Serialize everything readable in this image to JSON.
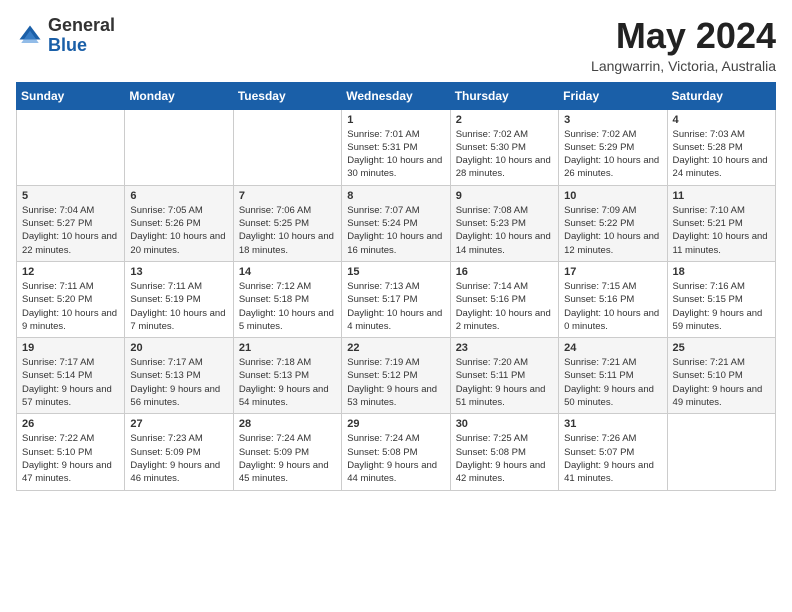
{
  "header": {
    "logo_general": "General",
    "logo_blue": "Blue",
    "month_title": "May 2024",
    "location": "Langwarrin, Victoria, Australia"
  },
  "weekdays": [
    "Sunday",
    "Monday",
    "Tuesday",
    "Wednesday",
    "Thursday",
    "Friday",
    "Saturday"
  ],
  "weeks": [
    [
      {
        "day": "",
        "sunrise": "",
        "sunset": "",
        "daylight": ""
      },
      {
        "day": "",
        "sunrise": "",
        "sunset": "",
        "daylight": ""
      },
      {
        "day": "",
        "sunrise": "",
        "sunset": "",
        "daylight": ""
      },
      {
        "day": "1",
        "sunrise": "Sunrise: 7:01 AM",
        "sunset": "Sunset: 5:31 PM",
        "daylight": "Daylight: 10 hours and 30 minutes."
      },
      {
        "day": "2",
        "sunrise": "Sunrise: 7:02 AM",
        "sunset": "Sunset: 5:30 PM",
        "daylight": "Daylight: 10 hours and 28 minutes."
      },
      {
        "day": "3",
        "sunrise": "Sunrise: 7:02 AM",
        "sunset": "Sunset: 5:29 PM",
        "daylight": "Daylight: 10 hours and 26 minutes."
      },
      {
        "day": "4",
        "sunrise": "Sunrise: 7:03 AM",
        "sunset": "Sunset: 5:28 PM",
        "daylight": "Daylight: 10 hours and 24 minutes."
      }
    ],
    [
      {
        "day": "5",
        "sunrise": "Sunrise: 7:04 AM",
        "sunset": "Sunset: 5:27 PM",
        "daylight": "Daylight: 10 hours and 22 minutes."
      },
      {
        "day": "6",
        "sunrise": "Sunrise: 7:05 AM",
        "sunset": "Sunset: 5:26 PM",
        "daylight": "Daylight: 10 hours and 20 minutes."
      },
      {
        "day": "7",
        "sunrise": "Sunrise: 7:06 AM",
        "sunset": "Sunset: 5:25 PM",
        "daylight": "Daylight: 10 hours and 18 minutes."
      },
      {
        "day": "8",
        "sunrise": "Sunrise: 7:07 AM",
        "sunset": "Sunset: 5:24 PM",
        "daylight": "Daylight: 10 hours and 16 minutes."
      },
      {
        "day": "9",
        "sunrise": "Sunrise: 7:08 AM",
        "sunset": "Sunset: 5:23 PM",
        "daylight": "Daylight: 10 hours and 14 minutes."
      },
      {
        "day": "10",
        "sunrise": "Sunrise: 7:09 AM",
        "sunset": "Sunset: 5:22 PM",
        "daylight": "Daylight: 10 hours and 12 minutes."
      },
      {
        "day": "11",
        "sunrise": "Sunrise: 7:10 AM",
        "sunset": "Sunset: 5:21 PM",
        "daylight": "Daylight: 10 hours and 11 minutes."
      }
    ],
    [
      {
        "day": "12",
        "sunrise": "Sunrise: 7:11 AM",
        "sunset": "Sunset: 5:20 PM",
        "daylight": "Daylight: 10 hours and 9 minutes."
      },
      {
        "day": "13",
        "sunrise": "Sunrise: 7:11 AM",
        "sunset": "Sunset: 5:19 PM",
        "daylight": "Daylight: 10 hours and 7 minutes."
      },
      {
        "day": "14",
        "sunrise": "Sunrise: 7:12 AM",
        "sunset": "Sunset: 5:18 PM",
        "daylight": "Daylight: 10 hours and 5 minutes."
      },
      {
        "day": "15",
        "sunrise": "Sunrise: 7:13 AM",
        "sunset": "Sunset: 5:17 PM",
        "daylight": "Daylight: 10 hours and 4 minutes."
      },
      {
        "day": "16",
        "sunrise": "Sunrise: 7:14 AM",
        "sunset": "Sunset: 5:16 PM",
        "daylight": "Daylight: 10 hours and 2 minutes."
      },
      {
        "day": "17",
        "sunrise": "Sunrise: 7:15 AM",
        "sunset": "Sunset: 5:16 PM",
        "daylight": "Daylight: 10 hours and 0 minutes."
      },
      {
        "day": "18",
        "sunrise": "Sunrise: 7:16 AM",
        "sunset": "Sunset: 5:15 PM",
        "daylight": "Daylight: 9 hours and 59 minutes."
      }
    ],
    [
      {
        "day": "19",
        "sunrise": "Sunrise: 7:17 AM",
        "sunset": "Sunset: 5:14 PM",
        "daylight": "Daylight: 9 hours and 57 minutes."
      },
      {
        "day": "20",
        "sunrise": "Sunrise: 7:17 AM",
        "sunset": "Sunset: 5:13 PM",
        "daylight": "Daylight: 9 hours and 56 minutes."
      },
      {
        "day": "21",
        "sunrise": "Sunrise: 7:18 AM",
        "sunset": "Sunset: 5:13 PM",
        "daylight": "Daylight: 9 hours and 54 minutes."
      },
      {
        "day": "22",
        "sunrise": "Sunrise: 7:19 AM",
        "sunset": "Sunset: 5:12 PM",
        "daylight": "Daylight: 9 hours and 53 minutes."
      },
      {
        "day": "23",
        "sunrise": "Sunrise: 7:20 AM",
        "sunset": "Sunset: 5:11 PM",
        "daylight": "Daylight: 9 hours and 51 minutes."
      },
      {
        "day": "24",
        "sunrise": "Sunrise: 7:21 AM",
        "sunset": "Sunset: 5:11 PM",
        "daylight": "Daylight: 9 hours and 50 minutes."
      },
      {
        "day": "25",
        "sunrise": "Sunrise: 7:21 AM",
        "sunset": "Sunset: 5:10 PM",
        "daylight": "Daylight: 9 hours and 49 minutes."
      }
    ],
    [
      {
        "day": "26",
        "sunrise": "Sunrise: 7:22 AM",
        "sunset": "Sunset: 5:10 PM",
        "daylight": "Daylight: 9 hours and 47 minutes."
      },
      {
        "day": "27",
        "sunrise": "Sunrise: 7:23 AM",
        "sunset": "Sunset: 5:09 PM",
        "daylight": "Daylight: 9 hours and 46 minutes."
      },
      {
        "day": "28",
        "sunrise": "Sunrise: 7:24 AM",
        "sunset": "Sunset: 5:09 PM",
        "daylight": "Daylight: 9 hours and 45 minutes."
      },
      {
        "day": "29",
        "sunrise": "Sunrise: 7:24 AM",
        "sunset": "Sunset: 5:08 PM",
        "daylight": "Daylight: 9 hours and 44 minutes."
      },
      {
        "day": "30",
        "sunrise": "Sunrise: 7:25 AM",
        "sunset": "Sunset: 5:08 PM",
        "daylight": "Daylight: 9 hours and 42 minutes."
      },
      {
        "day": "31",
        "sunrise": "Sunrise: 7:26 AM",
        "sunset": "Sunset: 5:07 PM",
        "daylight": "Daylight: 9 hours and 41 minutes."
      },
      {
        "day": "",
        "sunrise": "",
        "sunset": "",
        "daylight": ""
      }
    ]
  ]
}
